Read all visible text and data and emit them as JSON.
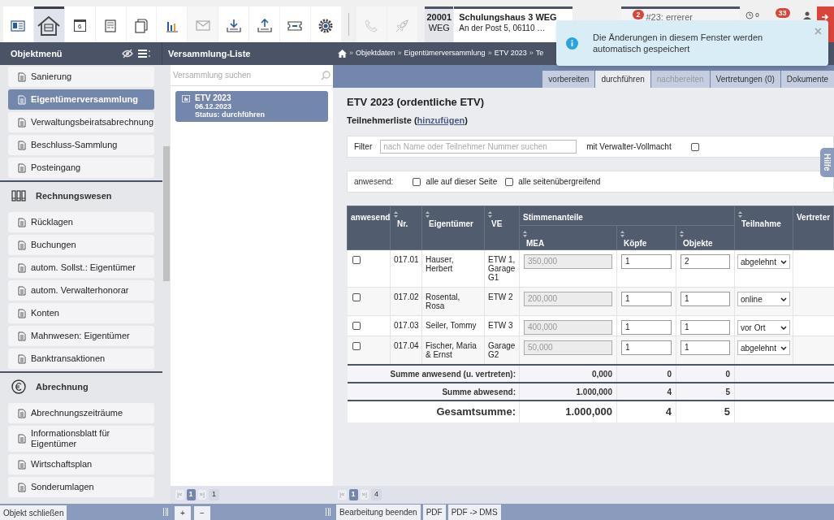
{
  "toolbar": {
    "items": [
      {
        "kind": "card",
        "selected": false,
        "disabled": false
      },
      {
        "kind": "house",
        "selected": true,
        "disabled": false
      },
      {
        "kind": "calendar",
        "selected": false,
        "disabled": false,
        "label": "6"
      },
      {
        "kind": "form",
        "selected": false,
        "disabled": false
      },
      {
        "kind": "pages",
        "selected": false,
        "disabled": false
      },
      {
        "kind": "chart",
        "selected": false,
        "disabled": false
      },
      {
        "kind": "mail",
        "selected": false,
        "disabled": true
      },
      {
        "kind": "download",
        "selected": false,
        "disabled": false
      },
      {
        "kind": "upload",
        "selected": false,
        "disabled": false
      },
      {
        "kind": "ticket",
        "selected": false,
        "disabled": false
      },
      {
        "kind": "gear",
        "selected": false,
        "disabled": false
      },
      {
        "kind": "separator"
      },
      {
        "kind": "phone",
        "selected": false,
        "disabled": true
      },
      {
        "kind": "rocket",
        "selected": false,
        "disabled": true
      }
    ],
    "property": {
      "number": "20001",
      "type": "WEG",
      "name": "Schulungshaus 3 WEG",
      "address": "An der Post 5, 06110 …"
    },
    "task": {
      "badge": "2",
      "text": "#23: errerer"
    },
    "timer": {
      "count": "0"
    },
    "messages": {
      "badge": "33"
    }
  },
  "toast": {
    "message": "Die Änderungen in diesem Fenster werden automatisch gespeichert",
    "close": "×"
  },
  "header": {
    "menu_title": "Objektmenü",
    "list_title": "Versammlung-Liste",
    "breadcrumb": [
      "Objektdaten",
      "Eigentümerversammlung",
      "ETV 2023",
      "Te"
    ],
    "separator": "»"
  },
  "sidebar": {
    "items": [
      {
        "kind": "item",
        "label": "Sanierung",
        "selected": false
      },
      {
        "kind": "item",
        "label": "Eigentümerversammlung",
        "selected": true
      },
      {
        "kind": "item",
        "label": "Verwaltungsbeiratsabrechnung",
        "selected": false
      },
      {
        "kind": "item",
        "label": "Beschluss-Sammlung",
        "selected": false
      },
      {
        "kind": "item",
        "label": "Posteingang",
        "selected": false
      },
      {
        "kind": "section",
        "label": "Rechnungswesen"
      },
      {
        "kind": "item",
        "label": "Rücklagen",
        "selected": false
      },
      {
        "kind": "item",
        "label": "Buchungen",
        "selected": false
      },
      {
        "kind": "item",
        "label": "autom. Sollst.: Eigentümer",
        "selected": false
      },
      {
        "kind": "item",
        "label": "autom. Verwalterhonorar",
        "selected": false
      },
      {
        "kind": "item",
        "label": "Konten",
        "selected": false
      },
      {
        "kind": "item",
        "label": "Mahnwesen: Eigentümer",
        "selected": false
      },
      {
        "kind": "item",
        "label": "Banktransaktionen",
        "selected": false
      },
      {
        "kind": "section",
        "label": "Abrechnung"
      },
      {
        "kind": "item",
        "label": "Abrechnungszeiträume",
        "selected": false
      },
      {
        "kind": "item",
        "label": "Informationsblatt für Eigentümer",
        "selected": false
      },
      {
        "kind": "item",
        "label": "Wirtschaftsplan",
        "selected": false
      },
      {
        "kind": "item",
        "label": "Sonderumlagen",
        "selected": false
      }
    ]
  },
  "list": {
    "search": {
      "placeholder": "Versammlung suchen"
    },
    "items": [
      {
        "title": "ETV 2023",
        "date": "06.12.2023",
        "status": "Status: durchführen",
        "selected": true
      }
    ],
    "pager": {
      "first": "|«",
      "page": "1",
      "last": "»|",
      "total": "1"
    }
  },
  "tabs": [
    {
      "label": "vorbereiten",
      "selected": false,
      "disabled": false
    },
    {
      "label": "durchführen",
      "selected": true,
      "disabled": false
    },
    {
      "label": "nachbereiten",
      "selected": false,
      "disabled": true
    },
    {
      "label": "Vertretungen (0)",
      "selected": false,
      "disabled": false
    },
    {
      "label": "Dokumente",
      "selected": false,
      "disabled": false
    }
  ],
  "help_tab": "Hilfe",
  "main": {
    "title": "ETV 2023 (ordentliche ETV)",
    "subtitle": "Teilnehmerliste (",
    "subtitle_link": "hinzufügen",
    "subtitle_end": ")",
    "filter": {
      "label": "Filter",
      "placeholder": "nach Name oder Teilnehmer Nummer suchen",
      "option": "mit Verwalter-Vollmacht",
      "checked": false
    },
    "present": {
      "label": "anwesend:",
      "options": [
        {
          "label": "alle auf dieser Seite",
          "checked": false
        },
        {
          "label": "alle seitenübergreifend",
          "checked": false
        }
      ]
    }
  },
  "table": {
    "columns": {
      "present": "anwesend",
      "nr": "Nr.",
      "owner": "Eigentümer",
      "unit": "VE",
      "shares": "Stimmenanteile",
      "mea": "MEA",
      "heads": "Köpfe",
      "objects": "Objekte",
      "participation": "Teilnahme",
      "proxy": "Vertreter"
    },
    "rows": [
      {
        "present": false,
        "nr": "017.01",
        "owner": "Hauser, Herbert",
        "unit": "ETW 1, Garage G1",
        "mea": "350,000",
        "heads": "1",
        "objects": "2",
        "participation": "abgelehnt"
      },
      {
        "present": false,
        "nr": "017.02",
        "owner": "Rosental, Rosa",
        "unit": "ETW 2",
        "mea": "200,000",
        "heads": "1",
        "objects": "1",
        "participation": "online"
      },
      {
        "present": false,
        "nr": "017.03",
        "owner": "Seiler, Tommy",
        "unit": "ETW 3",
        "mea": "400,000",
        "heads": "1",
        "objects": "1",
        "participation": "vor Ort"
      },
      {
        "present": false,
        "nr": "017.04",
        "owner": "Fischer, Maria & Ernst",
        "unit": "Garage G2",
        "mea": "50,000",
        "heads": "1",
        "objects": "1",
        "participation": "abgelehnt"
      }
    ],
    "totals": [
      {
        "kind": "small",
        "label": "Summe anwesend (u. vertreten):",
        "mea": "0,000",
        "heads": "0",
        "objects": "0"
      },
      {
        "kind": "small",
        "label": "Summe abwesend:",
        "mea": "1.000,000",
        "heads": "4",
        "objects": "5"
      },
      {
        "kind": "large",
        "label": "Gesamtsumme:",
        "mea": "1.000,000",
        "heads": "4",
        "objects": "5"
      }
    ],
    "pager": {
      "first": "|«",
      "page": "1",
      "last": "»|",
      "total": "4"
    }
  },
  "bottom": {
    "close": "Objekt schließen",
    "add": "+",
    "remove": "−",
    "actions": [
      "Bearbeitung beenden",
      "PDF",
      "PDF -> DMS"
    ]
  }
}
